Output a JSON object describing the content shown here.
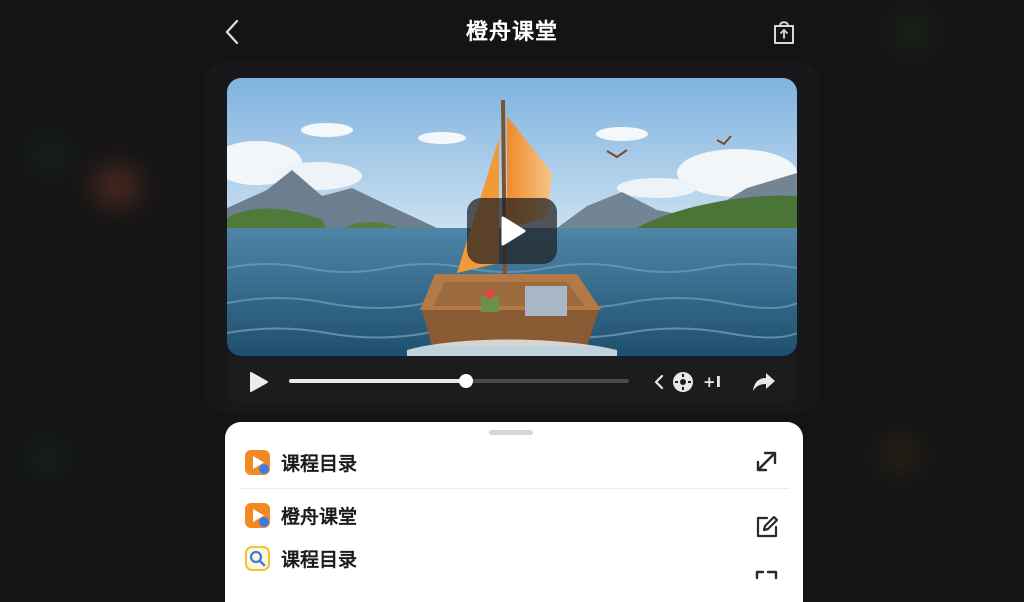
{
  "header": {
    "title": "橙舟课堂",
    "back_icon": "chevron-left-icon",
    "share_icon": "share-bag-icon"
  },
  "player": {
    "progress": 0.52,
    "skip_label": "+I",
    "play_icon": "play-icon",
    "prev_icon": "chevron-left-icon",
    "speed_icon": "speed-dial-icon",
    "share_icon": "share-arrow-icon"
  },
  "sheet": {
    "header_item": {
      "label": "课程目录",
      "icon": "orange-play-app-icon",
      "action_icon": "expand-arrow-icon"
    },
    "items": [
      {
        "label": "橙舟课堂",
        "icon": "orange-play-app-icon",
        "action_icon": "edit-icon"
      },
      {
        "label": "课程目录",
        "icon": "catalog-search-icon",
        "action_icon": "more-icon"
      }
    ]
  },
  "colors": {
    "background": "#141416",
    "brand_orange": "#f28a24",
    "brand_blue": "#3b7be8",
    "sheet": "#ffffff"
  }
}
